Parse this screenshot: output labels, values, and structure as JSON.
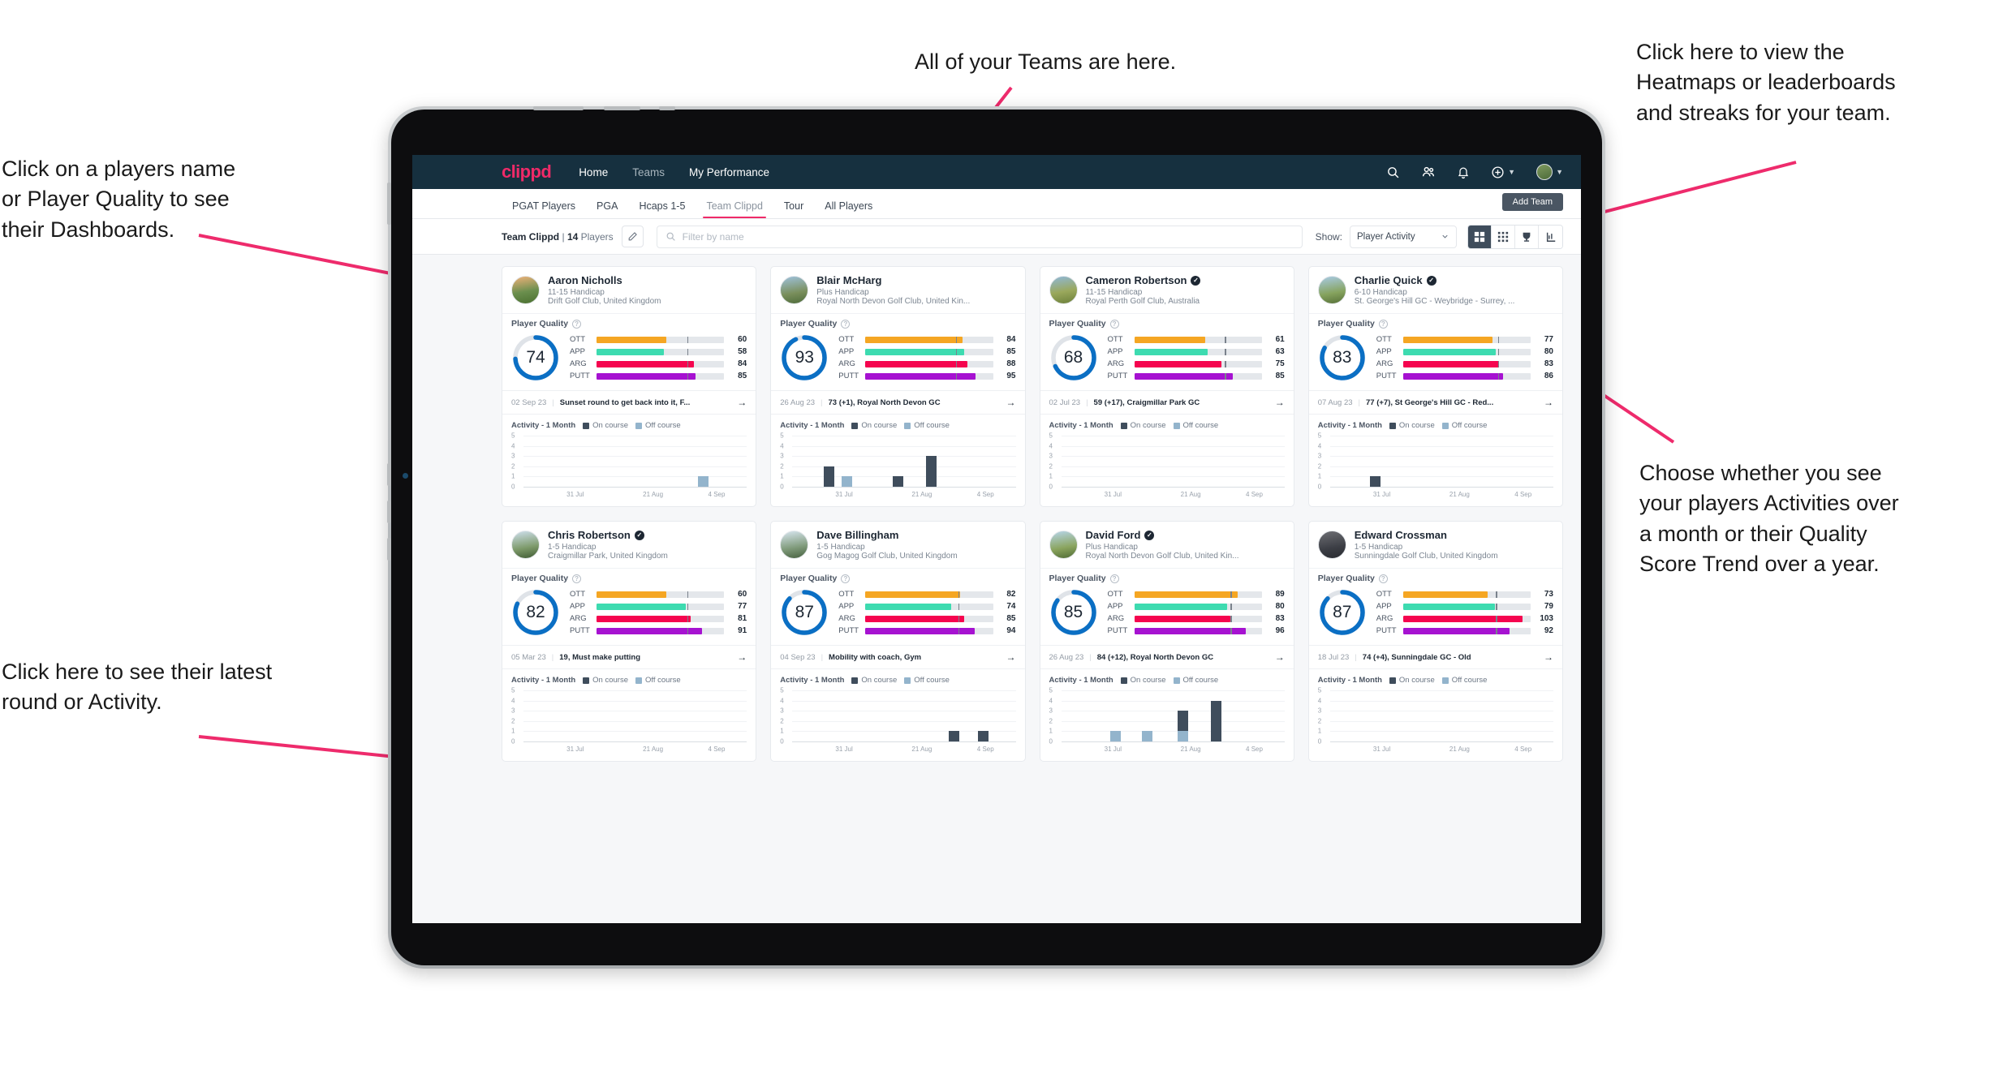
{
  "annotations": {
    "top": "All of your Teams are here.",
    "top_right": "Click here to view the\nHeatmaps or leaderboards\nand streaks for your team.",
    "left_top": "Click on a players name\nor Player Quality to see\ntheir Dashboards.",
    "left_bottom": "Click here to see their latest\nround or Activity.",
    "right_bottom": "Choose whether you see\nyour players Activities over\na month or their Quality\nScore Trend over a year."
  },
  "colors": {
    "brand_pink": "#ef2a68",
    "topbar": "#16303f",
    "ott": "#f5a623",
    "app": "#3ddbb0",
    "arg": "#f5054f",
    "putt": "#a612d1",
    "ring": "#0b6fc4",
    "on_course": "#3f4d5c",
    "off_course": "#93b4cc"
  },
  "topnav": {
    "logo": "clippd",
    "links": [
      {
        "label": "Home",
        "active": true
      },
      {
        "label": "Teams",
        "active": false
      },
      {
        "label": "My Performance",
        "active": true
      }
    ],
    "icons": [
      "search-icon",
      "people-icon",
      "bell-icon",
      "plus-circle-icon",
      "avatar"
    ]
  },
  "tabs": [
    {
      "label": "PGAT Players",
      "active": false
    },
    {
      "label": "PGA",
      "active": false
    },
    {
      "label": "Hcaps 1-5",
      "active": false
    },
    {
      "label": "Team Clippd",
      "active": true
    },
    {
      "label": "Tour",
      "active": false
    },
    {
      "label": "All Players",
      "active": false
    }
  ],
  "add_team_label": "Add Team",
  "filterbar": {
    "team_name": "Team Clippd",
    "separator": "|",
    "player_count": "14",
    "players_word": "Players",
    "search_placeholder": "Filter by name",
    "search_value": "",
    "show_label": "Show:",
    "show_value": "Player Activity",
    "view_buttons": [
      "grid-view-icon",
      "dense-grid-icon",
      "trophy-icon",
      "chart-icon"
    ]
  },
  "card_labels": {
    "quality_title": "Player Quality",
    "activity_title": "Activity - 1 Month",
    "legend_on": "On course",
    "legend_off": "Off course",
    "metrics": [
      "OTT",
      "APP",
      "ARG",
      "PUTT"
    ],
    "y_ticks": [
      "5",
      "4",
      "3",
      "2",
      "1",
      "0"
    ],
    "x_ticks": [
      "31 Jul",
      "21 Aug",
      "4 Sep"
    ]
  },
  "players": [
    {
      "name": "Aaron Nicholls",
      "verified": false,
      "handicap": "11-15 Handicap",
      "club": "Drift Golf Club, United Kingdom",
      "quality": 74,
      "metrics": [
        {
          "key": "OTT",
          "value": 60,
          "mark": 78
        },
        {
          "key": "APP",
          "value": 58,
          "mark": 78
        },
        {
          "key": "ARG",
          "value": 84,
          "mark": 78
        },
        {
          "key": "PUTT",
          "value": 85,
          "mark": 78
        }
      ],
      "round_date": "02 Sep 23",
      "round_text": "Sunset round to get back into it, F...",
      "activity": [
        {
          "x": 78,
          "h": 1,
          "type": "off"
        }
      ]
    },
    {
      "name": "Blair McHarg",
      "verified": false,
      "handicap": "Plus Handicap",
      "club": "Royal North Devon Golf Club, United Kin...",
      "quality": 93,
      "metrics": [
        {
          "key": "OTT",
          "value": 84,
          "mark": 78
        },
        {
          "key": "APP",
          "value": 85,
          "mark": 78
        },
        {
          "key": "ARG",
          "value": 88,
          "mark": 78
        },
        {
          "key": "PUTT",
          "value": 95,
          "mark": 78
        }
      ],
      "round_date": "26 Aug 23",
      "round_text": "73 (+1), Royal North Devon GC",
      "activity": [
        {
          "x": 14,
          "h": 2,
          "type": "on"
        },
        {
          "x": 22,
          "h": 1,
          "type": "off"
        },
        {
          "x": 45,
          "h": 1,
          "type": "on"
        },
        {
          "x": 60,
          "h": 3,
          "type": "on"
        }
      ]
    },
    {
      "name": "Cameron Robertson",
      "verified": true,
      "handicap": "11-15 Handicap",
      "club": "Royal Perth Golf Club, Australia",
      "quality": 68,
      "metrics": [
        {
          "key": "OTT",
          "value": 61,
          "mark": 78
        },
        {
          "key": "APP",
          "value": 63,
          "mark": 78
        },
        {
          "key": "ARG",
          "value": 75,
          "mark": 78
        },
        {
          "key": "PUTT",
          "value": 85,
          "mark": 78
        }
      ],
      "round_date": "02 Jul 23",
      "round_text": "59 (+17), Craigmillar Park GC",
      "activity": []
    },
    {
      "name": "Charlie Quick",
      "verified": true,
      "handicap": "6-10 Handicap",
      "club": "St. George's Hill GC - Weybridge - Surrey, ...",
      "quality": 83,
      "metrics": [
        {
          "key": "OTT",
          "value": 77,
          "mark": 82
        },
        {
          "key": "APP",
          "value": 80,
          "mark": 82
        },
        {
          "key": "ARG",
          "value": 83,
          "mark": 82
        },
        {
          "key": "PUTT",
          "value": 86,
          "mark": 82
        }
      ],
      "round_date": "07 Aug 23",
      "round_text": "77 (+7), St George's Hill GC - Red...",
      "activity": [
        {
          "x": 18,
          "h": 1,
          "type": "on"
        }
      ]
    },
    {
      "name": "Chris Robertson",
      "verified": true,
      "handicap": "1-5 Handicap",
      "club": "Craigmillar Park, United Kingdom",
      "quality": 82,
      "metrics": [
        {
          "key": "OTT",
          "value": 60,
          "mark": 78
        },
        {
          "key": "APP",
          "value": 77,
          "mark": 78
        },
        {
          "key": "ARG",
          "value": 81,
          "mark": 78
        },
        {
          "key": "PUTT",
          "value": 91,
          "mark": 78
        }
      ],
      "round_date": "05 Mar 23",
      "round_text": "19, Must make putting",
      "activity": []
    },
    {
      "name": "Dave Billingham",
      "verified": false,
      "handicap": "1-5 Handicap",
      "club": "Gog Magog Golf Club, United Kingdom",
      "quality": 87,
      "metrics": [
        {
          "key": "OTT",
          "value": 82,
          "mark": 80
        },
        {
          "key": "APP",
          "value": 74,
          "mark": 80
        },
        {
          "key": "ARG",
          "value": 85,
          "mark": 80
        },
        {
          "key": "PUTT",
          "value": 94,
          "mark": 80
        }
      ],
      "round_date": "04 Sep 23",
      "round_text": "Mobility with coach, Gym",
      "activity": [
        {
          "x": 70,
          "h": 1,
          "type": "on"
        },
        {
          "x": 83,
          "h": 1,
          "type": "on"
        }
      ]
    },
    {
      "name": "David Ford",
      "verified": true,
      "handicap": "Plus Handicap",
      "club": "Royal North Devon Golf Club, United Kin...",
      "quality": 85,
      "metrics": [
        {
          "key": "OTT",
          "value": 89,
          "mark": 83
        },
        {
          "key": "APP",
          "value": 80,
          "mark": 83
        },
        {
          "key": "ARG",
          "value": 83,
          "mark": 83
        },
        {
          "key": "PUTT",
          "value": 96,
          "mark": 83
        }
      ],
      "round_date": "26 Aug 23",
      "round_text": "84 (+12), Royal North Devon GC",
      "activity": [
        {
          "x": 22,
          "h": 1,
          "type": "off"
        },
        {
          "x": 36,
          "h": 1,
          "type": "off"
        },
        {
          "x": 52,
          "h": 3,
          "type": "on"
        },
        {
          "x": 52,
          "h": 1,
          "type": "off"
        },
        {
          "x": 67,
          "h": 4,
          "type": "on"
        }
      ]
    },
    {
      "name": "Edward Crossman",
      "verified": false,
      "handicap": "1-5 Handicap",
      "club": "Sunningdale Golf Club, United Kingdom",
      "quality": 87,
      "metrics": [
        {
          "key": "OTT",
          "value": 73,
          "mark": 80
        },
        {
          "key": "APP",
          "value": 79,
          "mark": 80
        },
        {
          "key": "ARG",
          "value": 103,
          "mark": 80
        },
        {
          "key": "PUTT",
          "value": 92,
          "mark": 80
        }
      ],
      "round_date": "18 Jul 23",
      "round_text": "74 (+4), Sunningdale GC - Old",
      "activity": []
    }
  ]
}
